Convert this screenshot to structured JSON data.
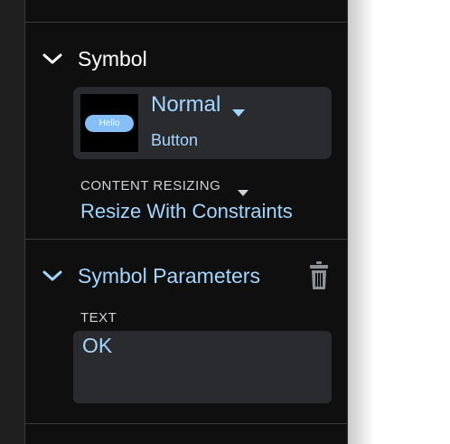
{
  "symbol_section": {
    "title": "Symbol",
    "instance": {
      "thumbnail_text": "Hello",
      "state": "Normal",
      "kind": "Button"
    },
    "content_resizing_label": "CONTENT RESIZING",
    "content_resizing_value": "Resize With Constraints"
  },
  "parameters_section": {
    "title": "Symbol Parameters",
    "text_label": "TEXT",
    "text_value": "OK"
  },
  "icons": {
    "collapse": "chevron-down-icon",
    "dropdown": "caret-down-icon",
    "delete": "trash-icon"
  },
  "colors": {
    "panel_background": "#0f0f0f",
    "field_background": "#2a2b2f",
    "accent_text": "#a3d6ff",
    "divider": "#3a3a3a"
  }
}
